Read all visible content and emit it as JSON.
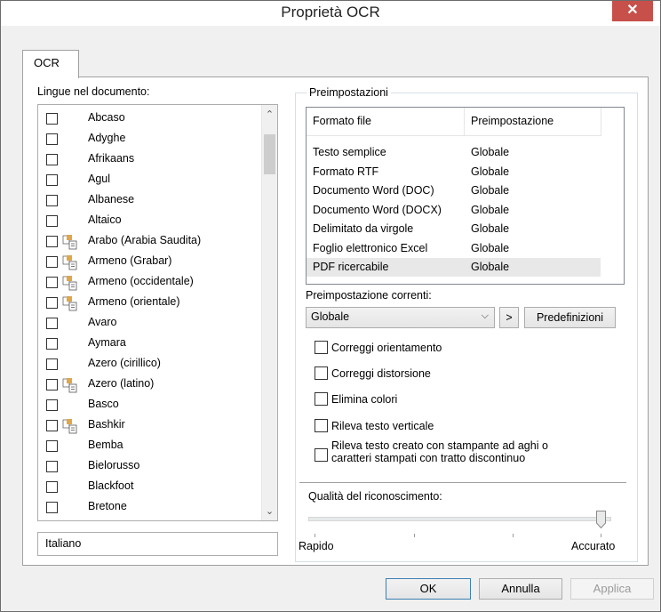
{
  "window": {
    "title": "Proprietà OCR",
    "close_label": "✕"
  },
  "tabs": [
    {
      "label": "OCR"
    }
  ],
  "languages": {
    "label": "Lingue nel documento:",
    "items": [
      {
        "name": "Abcaso",
        "dictionary_icon": false
      },
      {
        "name": "Adyghe",
        "dictionary_icon": false
      },
      {
        "name": "Afrikaans",
        "dictionary_icon": false
      },
      {
        "name": "Agul",
        "dictionary_icon": false
      },
      {
        "name": "Albanese",
        "dictionary_icon": false
      },
      {
        "name": "Altaico",
        "dictionary_icon": false
      },
      {
        "name": "Arabo (Arabia Saudita)",
        "dictionary_icon": true
      },
      {
        "name": "Armeno (Grabar)",
        "dictionary_icon": true
      },
      {
        "name": "Armeno (occidentale)",
        "dictionary_icon": true
      },
      {
        "name": "Armeno (orientale)",
        "dictionary_icon": true
      },
      {
        "name": "Avaro",
        "dictionary_icon": false
      },
      {
        "name": "Aymara",
        "dictionary_icon": false
      },
      {
        "name": "Azero (cirillico)",
        "dictionary_icon": false
      },
      {
        "name": "Azero (latino)",
        "dictionary_icon": true
      },
      {
        "name": "Basco",
        "dictionary_icon": false
      },
      {
        "name": "Bashkir",
        "dictionary_icon": true
      },
      {
        "name": "Bemba",
        "dictionary_icon": false
      },
      {
        "name": "Bielorusso",
        "dictionary_icon": false
      },
      {
        "name": "Blackfoot",
        "dictionary_icon": false
      },
      {
        "name": "Bretone",
        "dictionary_icon": false
      }
    ],
    "selected_text": "Italiano"
  },
  "presets": {
    "group_label": "Preimpostazioni",
    "columns": [
      "Formato file",
      "Preimpostazione"
    ],
    "rows": [
      [
        "Testo semplice",
        "Globale"
      ],
      [
        "Formato RTF",
        "Globale"
      ],
      [
        "Documento Word (DOC)",
        "Globale"
      ],
      [
        "Documento Word (DOCX)",
        "Globale"
      ],
      [
        "Delimitato da virgole",
        "Globale"
      ],
      [
        "Foglio elettronico Excel",
        "Globale"
      ],
      [
        "PDF ricercabile",
        "Globale"
      ]
    ],
    "current_label": "Preimpostazione correnti:",
    "current_value": "Globale",
    "arrow_button": ">",
    "defaults_button": "Predefinizioni"
  },
  "options": [
    {
      "label": "Correggi orientamento",
      "checked": false
    },
    {
      "label": "Correggi distorsione",
      "checked": false
    },
    {
      "label": "Elimina colori",
      "checked": false
    },
    {
      "label": "Rileva testo verticale",
      "checked": false
    },
    {
      "label": "Rileva testo creato con stampante ad aghi o\ncaratteri stampati con tratto discontinuo",
      "checked": false
    }
  ],
  "quality": {
    "label": "Qualità del riconoscimento:",
    "min_label": "Rapido",
    "max_label": "Accurato",
    "level_fraction": 1.0
  },
  "footer": {
    "ok": "OK",
    "cancel": "Annulla",
    "apply": "Applica"
  },
  "colors": {
    "close_button": "#c7504a",
    "selected_row": "#e8e8e8",
    "icon_orange": "#e0a64a"
  }
}
